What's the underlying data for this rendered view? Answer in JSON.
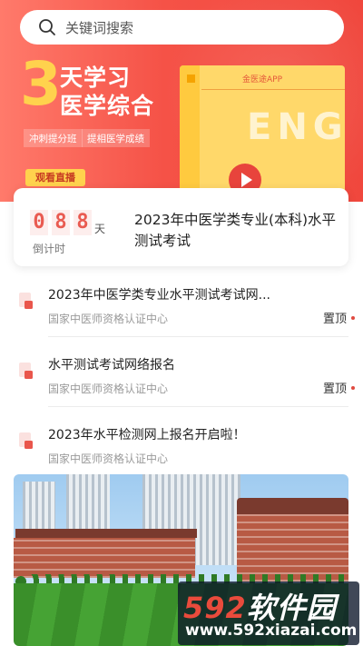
{
  "search": {
    "placeholder": "关键词搜索"
  },
  "banner": {
    "big_number": "3",
    "headline_line1": "天学习",
    "headline_line2": "医学综合",
    "tags": [
      "冲刺提分班",
      "提相医学成绩"
    ],
    "live_button": "观看直播",
    "book_brand": "金医途APP",
    "book_text": "ENGL"
  },
  "countdown": {
    "digits": [
      "0",
      "8",
      "8"
    ],
    "unit": "天",
    "label": "倒计时",
    "exam_title": "2023年中医学类专业(本科)水平测试考试"
  },
  "news": [
    {
      "title": "2023年中医学类专业水平测试考试网...",
      "source": "国家中医师资格认证中心",
      "badge": "置顶"
    },
    {
      "title": "水平测试考试网络报名",
      "source": "国家中医师资格认证中心",
      "badge": "置顶"
    },
    {
      "title": "2023年水平检测网上报名开启啦！",
      "source": "国家中医师资格认证中心",
      "badge": ""
    }
  ],
  "watermark": {
    "logo_num": "592",
    "logo_text": "软件园",
    "url": "www.592xiazai.com"
  },
  "colors": {
    "accent": "#f0473d",
    "digit_bg": "#fdeeed",
    "digit_text": "#e95b51",
    "live_button": "#ffd24d"
  },
  "icons": {
    "search": "search-icon",
    "news": "document-icon",
    "play": "play-icon"
  }
}
